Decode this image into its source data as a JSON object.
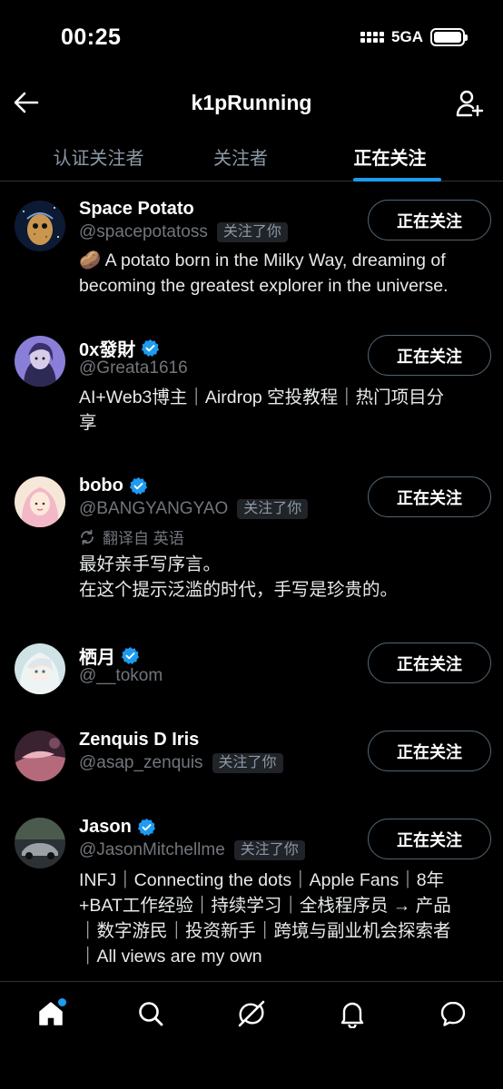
{
  "status_bar": {
    "time": "00:25",
    "network": "5GA",
    "battery_level": 1.0
  },
  "header": {
    "title": "k1pRunning",
    "back_icon": "arrow-left-icon",
    "add_icon": "add-user-icon"
  },
  "tabs": [
    {
      "label": "认证关注者",
      "active": false
    },
    {
      "label": "关注者",
      "active": false
    },
    {
      "label": "正在关注",
      "active": true
    }
  ],
  "colors": {
    "background": "#000000",
    "accent": "#1d9bf0",
    "muted": "#71767b",
    "text": "#e7e9ea",
    "border": "#2f3336"
  },
  "users": [
    {
      "name": "Space Potato",
      "handle": "@spacepotatoss",
      "verified": false,
      "follows_you": "关注了你",
      "bio": "🥔 A potato born in the Milky Way, dreaming of\nbecoming the greatest explorer in the universe.",
      "button": "正在关注"
    },
    {
      "name": "0x發財",
      "handle": "@Greata1616",
      "verified": true,
      "follows_you": "",
      "bio": "AI+Web3博主｜Airdrop 空投教程｜热门项目分\n享",
      "button": "正在关注"
    },
    {
      "name": "bobo",
      "handle": "@BANGYANGYAO",
      "verified": true,
      "follows_you": "关注了你",
      "translated": "翻译自 英语",
      "bio": "最好亲手写序言。\n在这个提示泛滥的时代，手写是珍贵的。",
      "button": "正在关注"
    },
    {
      "name": "栖月",
      "handle": "@__tokom",
      "verified": true,
      "follows_you": "",
      "bio": "",
      "button": "正在关注"
    },
    {
      "name": "Zenquis D Iris",
      "handle": "@asap_zenquis",
      "verified": false,
      "follows_you": "关注了你",
      "bio": "",
      "button": "正在关注"
    },
    {
      "name": "Jason",
      "handle": "@JasonMitchellme",
      "verified": true,
      "follows_you": "关注了你",
      "bio": "INFJ｜Connecting the dots｜Apple Fans｜8年\n+BAT工作经验｜持续学习｜全栈程序员 → 产品\n｜数字游民｜投资新手｜跨境与副业机会探索者\n｜All views are my own",
      "button": "正在关注"
    }
  ],
  "bottom_nav": [
    {
      "icon": "home-icon",
      "active": true,
      "has_notification_dot": true
    },
    {
      "icon": "search-icon",
      "active": false
    },
    {
      "icon": "grok-icon",
      "active": false
    },
    {
      "icon": "bell-icon",
      "active": false
    },
    {
      "icon": "messages-icon",
      "active": false
    }
  ]
}
